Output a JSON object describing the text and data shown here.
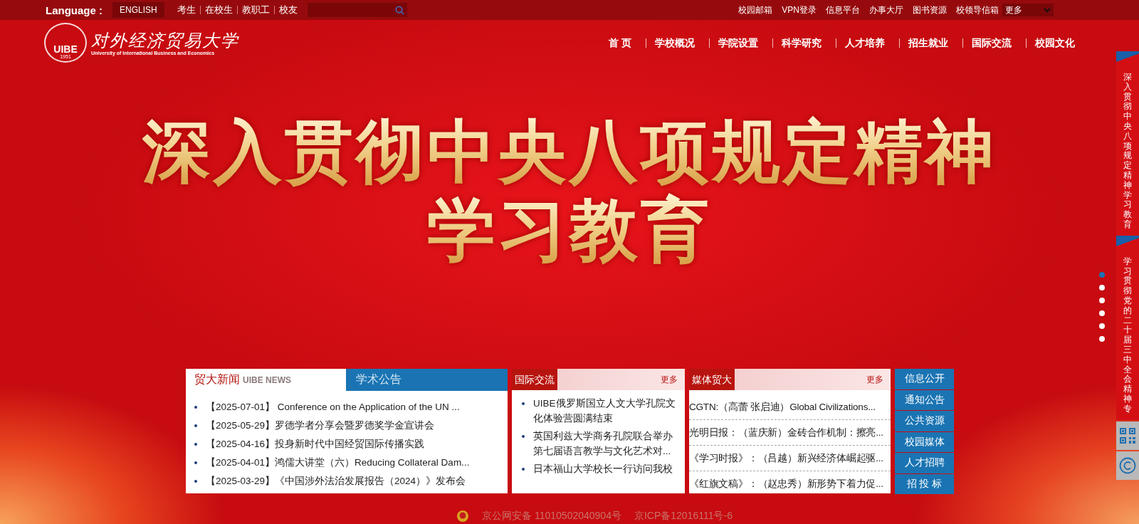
{
  "top_bar": {
    "language_label": "Language :",
    "english_button": "ENGLISH",
    "audience_links": [
      "考生",
      "在校生",
      "教职工",
      "校友"
    ],
    "quick_links": [
      "校园邮箱",
      "VPN登录",
      "信息平台",
      "办事大厅",
      "图书资源",
      "校领导信箱"
    ],
    "more_select": "更多"
  },
  "logo": {
    "abbr": "UIBE",
    "year": "1951",
    "name": "对外经济贸易大学",
    "english": "University of International Business and Economics"
  },
  "nav": [
    "首 页",
    "学校概况",
    "学院设置",
    "科学研究",
    "人才培养",
    "招生就业",
    "国际交流",
    "校园文化"
  ],
  "hero": {
    "lines": [
      "深入贯彻中央八项规定精神",
      "学习教育"
    ]
  },
  "slider_dots": [
    {
      "selected": true
    },
    {
      "selected": false
    },
    {
      "selected": false
    },
    {
      "selected": false
    },
    {
      "selected": false
    },
    {
      "selected": false
    }
  ],
  "side_banners": [
    "深入贯彻中央八项规定精神学习教育",
    "学习贯彻党的二十届三中全会精神专"
  ],
  "news_panel": {
    "tabs": [
      {
        "label": "贸大新闻",
        "sublabel": "UIBE NEWS",
        "selected": true
      },
      {
        "label": "学术公告",
        "selected": false
      }
    ],
    "items": [
      {
        "date": "【2025-07-01】",
        "title": " Conference on the Application of the UN ..."
      },
      {
        "date": "【2025-05-29】",
        "title": "罗德学者分享会暨罗德奖学金宣讲会"
      },
      {
        "date": "【2025-04-16】",
        "title": "投身新时代中国经贸国际传播实践"
      },
      {
        "date": "【2025-04-01】",
        "title": "鸿儒大讲堂（六）Reducing Collateral Dam..."
      },
      {
        "date": "【2025-03-29】",
        "title": "《中国涉外法治发展报告（2024）》发布会"
      }
    ]
  },
  "exchange_panel": {
    "title": "国际交流",
    "more": "更多",
    "items": [
      "UIBE俄罗斯国立人文大学孔院文化体验营圆满结束",
      "英国利兹大学商务孔院联合举办第七届语言教学与文化艺术对...",
      "日本福山大学校长一行访问我校"
    ]
  },
  "media_panel": {
    "title": "媒体贸大",
    "more": "更多",
    "items": [
      "CGTN:（高蕾 张启迪）Global Civilizations...",
      "光明日报：（蓝庆新）金砖合作机制：擦亮...",
      "《学习时报》：（吕越）新兴经济体崛起驱...",
      "《红旗文稿》：（赵忠秀）新形势下着力促..."
    ]
  },
  "quick_buttons": [
    "信息公开",
    "通知公告",
    "公共资源",
    "校园媒体",
    "人才招聘",
    "招 投 标"
  ],
  "footer": {
    "security_record": "京公网安备 11010502040904号",
    "icp_record": "京ICP备12016111号-6"
  }
}
